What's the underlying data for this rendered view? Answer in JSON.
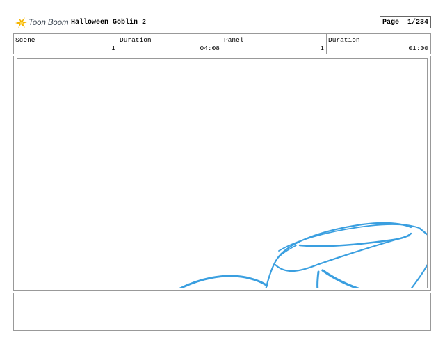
{
  "header": {
    "logo_text": "Toon Boom",
    "project_title": "Halloween Goblin 2",
    "page_label": "Page",
    "page_value": "1/234"
  },
  "info": {
    "scene_label": "Scene",
    "scene_value": "1",
    "scene_duration_label": "Duration",
    "scene_duration_value": "04:08",
    "panel_label": "Panel",
    "panel_value": "1",
    "panel_duration_label": "Duration",
    "panel_duration_value": "01:00"
  },
  "colors": {
    "sketch_stroke": "#3a9fe0",
    "logo_accent": "#f5b400"
  },
  "icons": {
    "logo": "starburst-logo-icon"
  }
}
